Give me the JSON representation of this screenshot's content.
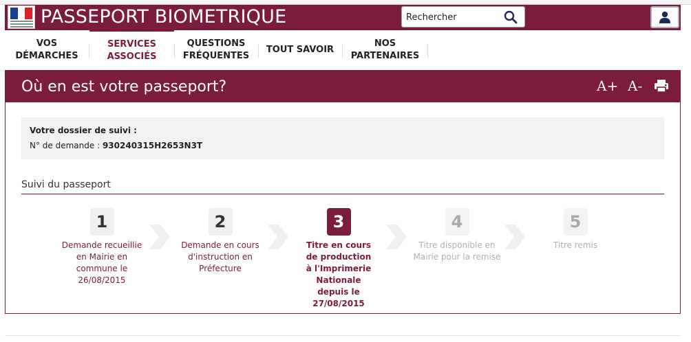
{
  "header": {
    "site_title": "PASSEPORT BIOMETRIQUE",
    "search_placeholder": "Rechercher",
    "colors": {
      "brand": "#7b1c3a"
    }
  },
  "nav": {
    "items": [
      {
        "label": "VOS DÉMARCHES"
      },
      {
        "label": "SERVICES ASSOCIÉS",
        "active": true
      },
      {
        "label": "QUESTIONS FRÉQUENTES"
      },
      {
        "label": "TOUT SAVOIR"
      },
      {
        "label": "NOS PARTENAIRES"
      }
    ]
  },
  "card": {
    "title": "Où en est votre passeport?",
    "tools": {
      "font_increase": "A+",
      "font_decrease": "A-",
      "print_icon": "print-icon"
    },
    "dossier": {
      "title": "Votre dossier de suivi :",
      "request_label": "N° de demande :",
      "request_number": "930240315H2653N3T"
    },
    "suivi_title": "Suivi du passeport",
    "steps": [
      {
        "num": "1",
        "label": "Demande recueillie en Mairie en commune le 26/08/2015",
        "state": "done"
      },
      {
        "num": "2",
        "label": "Demande en cours d'instruction en Préfecture",
        "state": "done"
      },
      {
        "num": "3",
        "label": "Titre en cours de production à l'Imprimerie Nationale depuis le 27/08/2015",
        "state": "current"
      },
      {
        "num": "4",
        "label": "Titre disponible en Mairie pour la remise",
        "state": "future"
      },
      {
        "num": "5",
        "label": "Titre remis",
        "state": "future"
      }
    ]
  }
}
